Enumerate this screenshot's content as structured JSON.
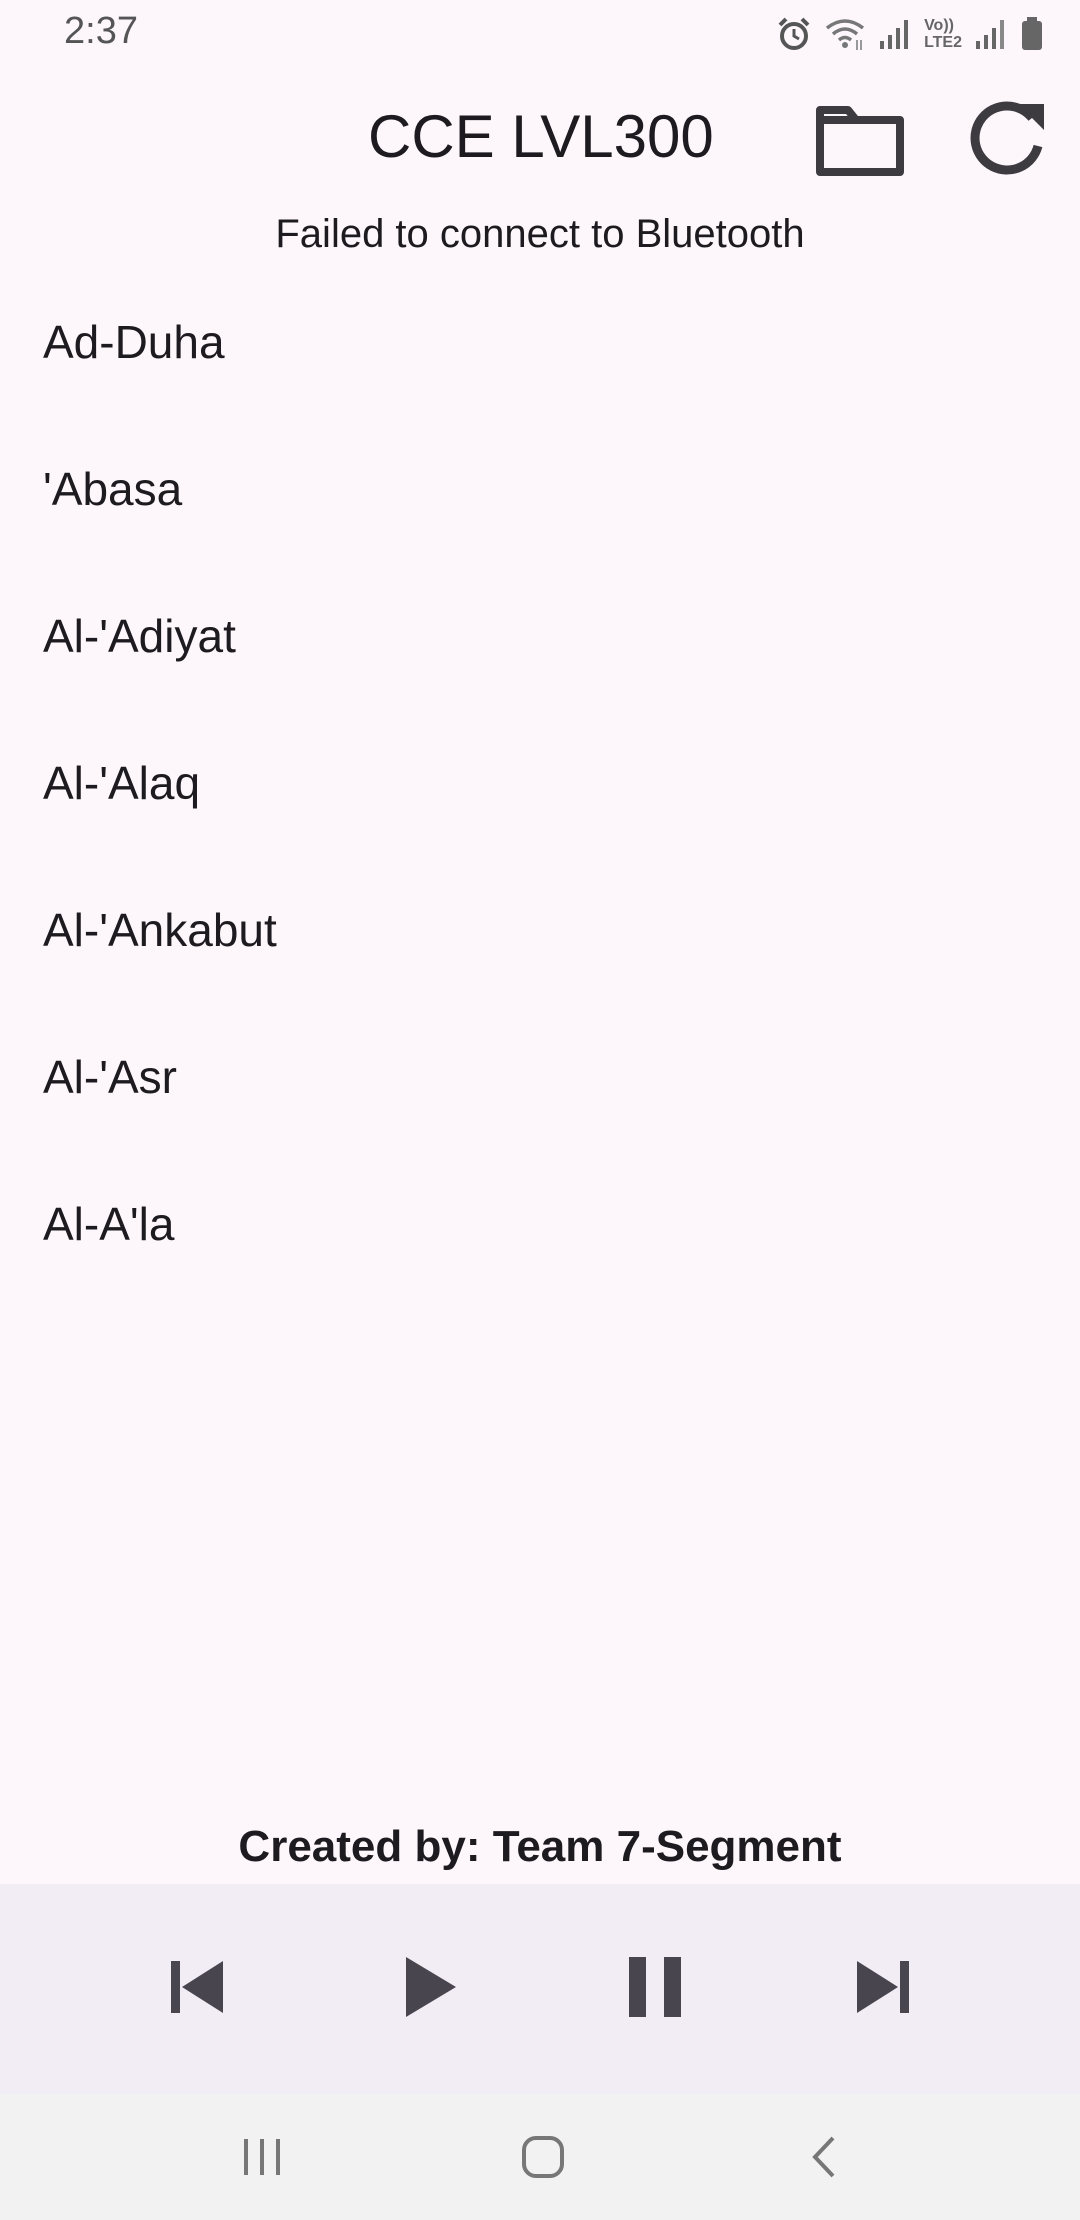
{
  "status_bar": {
    "time": "2:37",
    "icons": [
      "alarm-icon",
      "wifi-icon",
      "signal-icon",
      "volte-lte2-icon",
      "signal-icon-2",
      "battery-icon"
    ],
    "volte_label_top": "Vo))",
    "volte_label_bottom": "LTE2"
  },
  "app_bar": {
    "title": "CCE LVL300",
    "actions": [
      "folder-icon",
      "refresh-icon"
    ]
  },
  "bluetooth_status": "Failed to connect to Bluetooth",
  "songs": [
    {
      "title": "Ad-Duha"
    },
    {
      "title": "'Abasa"
    },
    {
      "title": "Al-'Adiyat"
    },
    {
      "title": "Al-'Alaq"
    },
    {
      "title": "Al-'Ankabut"
    },
    {
      "title": "Al-'Asr"
    },
    {
      "title": "Al-A'la"
    }
  ],
  "credit": "Created by: Team 7-Segment",
  "player": {
    "controls": [
      "skip-previous-icon",
      "play-icon",
      "pause-icon",
      "skip-next-icon"
    ]
  },
  "nav": {
    "buttons": [
      "recents-icon",
      "home-icon",
      "back-icon"
    ]
  },
  "colors": {
    "background": "#fdf7fc",
    "player_bar": "#f2ecf5",
    "nav_bar": "#f2f2f2",
    "icon": "#49454f",
    "text": "#1d1b20"
  }
}
